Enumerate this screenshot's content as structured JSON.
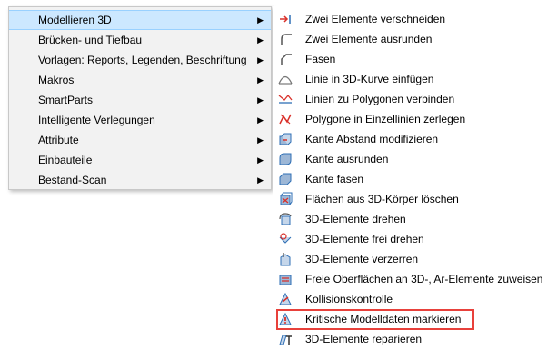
{
  "main_menu": {
    "items": [
      {
        "label": "Modellieren 3D",
        "arrow": "▶"
      },
      {
        "label": "Brücken- und Tiefbau",
        "arrow": "▶"
      },
      {
        "label": "Vorlagen: Reports, Legenden, Beschriftung",
        "arrow": "▶"
      },
      {
        "label": "Makros",
        "arrow": "▶"
      },
      {
        "label": "SmartParts",
        "arrow": "▶"
      },
      {
        "label": "Intelligente Verlegungen",
        "arrow": "▶"
      },
      {
        "label": "Attribute",
        "arrow": "▶"
      },
      {
        "label": "Einbauteile",
        "arrow": "▶"
      },
      {
        "label": "Bestand-Scan",
        "arrow": "▶"
      }
    ],
    "highlighted_item": "Modellieren 3D"
  },
  "submenu": {
    "items": [
      {
        "label": "Zwei Elemente verschneiden",
        "icon": "intersect-icon"
      },
      {
        "label": "Zwei Elemente ausrunden",
        "icon": "fillet-icon"
      },
      {
        "label": "Fasen",
        "icon": "chamfer-icon"
      },
      {
        "label": "Linie in 3D-Kurve einfügen",
        "icon": "line-curve-icon"
      },
      {
        "label": "Linien zu Polygonen verbinden",
        "icon": "join-polygon-icon"
      },
      {
        "label": "Polygone in Einzellinien zerlegen",
        "icon": "explode-polygon-icon"
      },
      {
        "label": "Kante Abstand modifizieren",
        "icon": "edge-offset-icon"
      },
      {
        "label": "Kante ausrunden",
        "icon": "edge-fillet-icon"
      },
      {
        "label": "Kante fasen",
        "icon": "edge-chamfer-icon"
      },
      {
        "label": "Flächen aus 3D-Körper löschen",
        "icon": "delete-faces-icon"
      },
      {
        "label": "3D-Elemente drehen",
        "icon": "rotate-3d-icon"
      },
      {
        "label": "3D-Elemente frei drehen",
        "icon": "free-rotate-icon"
      },
      {
        "label": "3D-Elemente verzerren",
        "icon": "distort-icon"
      },
      {
        "label": "Freie Oberflächen an 3D-, Ar-Elemente zuweisen",
        "icon": "assign-surface-icon"
      },
      {
        "label": "Kollisionskontrolle",
        "icon": "collision-icon"
      },
      {
        "label": "Kritische Modelldaten markieren",
        "icon": "critical-data-icon"
      },
      {
        "label": "3D-Elemente reparieren",
        "icon": "repair-icon"
      }
    ],
    "boxed_item": "Kritische Modelldaten markieren"
  },
  "colors": {
    "highlight": "#cce8ff",
    "highlight_border": "#99d1ff",
    "menu_background": "#f2f2f2",
    "red_box": "#e8413b",
    "icon_blue": "#2f6fb5",
    "icon_red": "#d9302a"
  }
}
